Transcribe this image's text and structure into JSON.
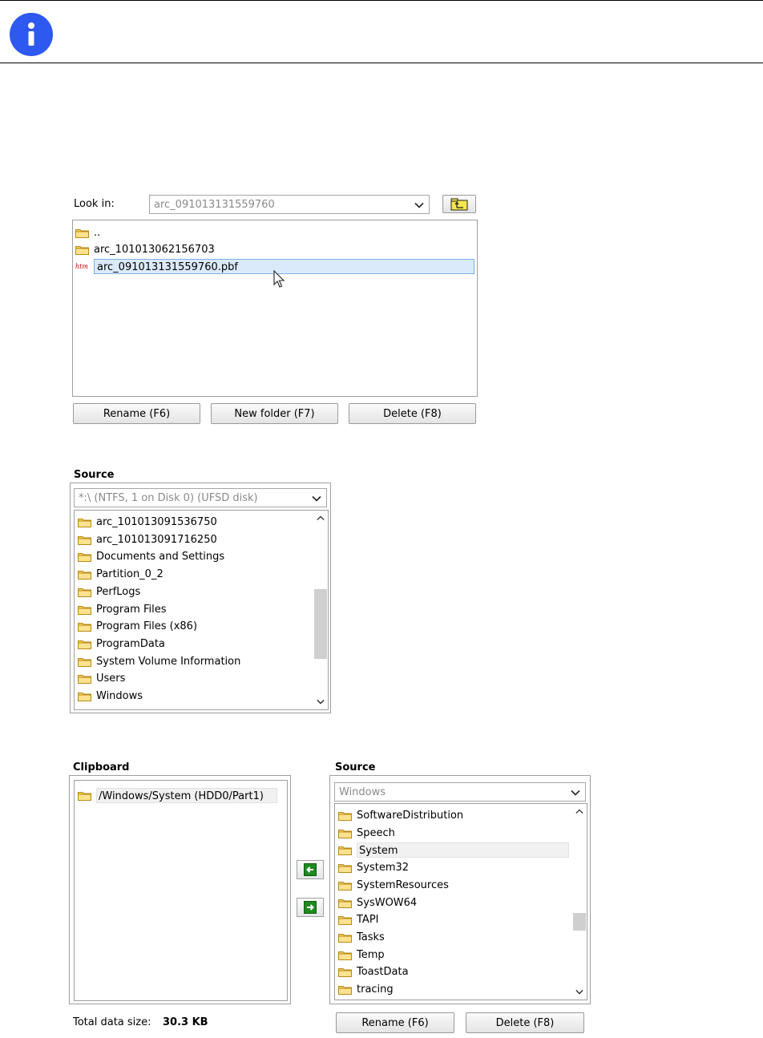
{
  "dialog1": {
    "look_in_label": "Look in:",
    "look_in_value": "arc_091013131559760",
    "items": [
      {
        "name": "..",
        "type": "folder"
      },
      {
        "name": "arc_101013062156703",
        "type": "folder"
      },
      {
        "name": "arc_091013131559760.pbf",
        "type": "file",
        "file_badge": "htm",
        "selected": true
      }
    ],
    "buttons": {
      "rename": "Rename (F6)",
      "new_folder": "New folder (F7)",
      "delete": "Delete (F8)"
    }
  },
  "source1": {
    "title": "Source",
    "combo_value": "*:\\  (NTFS, 1 on Disk 0) (UFSD disk)",
    "items": [
      "arc_101013091536750",
      "arc_101013091716250",
      "Documents and Settings",
      "Partition_0_2",
      "PerfLogs",
      "Program Files",
      "Program Files (x86)",
      "ProgramData",
      "System Volume Information",
      "Users",
      "Windows"
    ]
  },
  "clipboard": {
    "title": "Clipboard",
    "items": [
      "/Windows/System (HDD0/Part1)"
    ],
    "total_label": "Total data size:",
    "total_value": "30.3 KB"
  },
  "source2": {
    "title": "Source",
    "combo_value": "Windows",
    "items": [
      "SoftwareDistribution",
      "Speech",
      "System",
      "System32",
      "SystemResources",
      "SysWOW64",
      "TAPI",
      "Tasks",
      "Temp",
      "ToastData",
      "tracing"
    ],
    "highlighted": "System",
    "buttons": {
      "rename": "Rename (F6)",
      "delete": "Delete (F8)"
    }
  },
  "colors": {
    "info_blue": "#2d59f0",
    "selection_bg": "#dbeafb",
    "selection_border": "#7aaee3",
    "folder_yellow": "#f7d36b",
    "arrow_green": "#1f8a1f"
  }
}
